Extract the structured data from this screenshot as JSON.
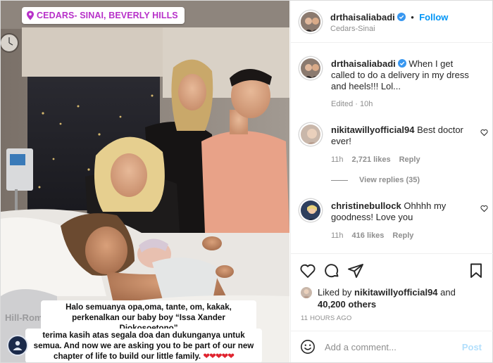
{
  "photo": {
    "location_sticker": "CEDARS- SINAI, BEVERLY HILLS",
    "caption_line1": "Halo semuanya opa,oma, tante, om, kakak, perkenalkan our baby boy “Issa Xander Djokosoetono”",
    "caption_line2": "terima kasih atas segala doa dan dukunganya untuk semua. And now we are asking you to be part of our new chapter of life to build our little family.",
    "caption_hearts": "❤❤❤❤❤",
    "watermark": "Hill-Rom"
  },
  "header": {
    "username": "drthaisaliabadi",
    "separator": "•",
    "follow_label": "Follow",
    "location": "Cedars-Sinai"
  },
  "caption_comment": {
    "username": "drthaisaliabadi",
    "text": "When I get called to do a delivery in my dress and heels!!! Lol...",
    "meta": "Edited · 10h"
  },
  "comments": [
    {
      "username": "nikitawillyofficial94",
      "text": "Best doctor ever!",
      "time": "11h",
      "likes": "2,721 likes",
      "reply": "Reply",
      "view_replies": "View replies (35)"
    },
    {
      "username": "christinebullock",
      "text": "Ohhhh my goodness! Love you",
      "time": "11h",
      "likes": "416 likes",
      "reply": "Reply"
    }
  ],
  "actions": {
    "liked_by_prefix": "Liked by",
    "liked_by_user": "nikitawillyofficial94",
    "and": "and",
    "others": "40,200 others",
    "time_ago": "11 HOURS AGO"
  },
  "add_comment": {
    "placeholder": "Add a comment...",
    "post_label": "Post"
  },
  "colors": {
    "accent_blue": "#0095f6",
    "muted": "#8e8e8e",
    "sticker_purple": "#b730c9",
    "heart_red": "#e0242f"
  }
}
